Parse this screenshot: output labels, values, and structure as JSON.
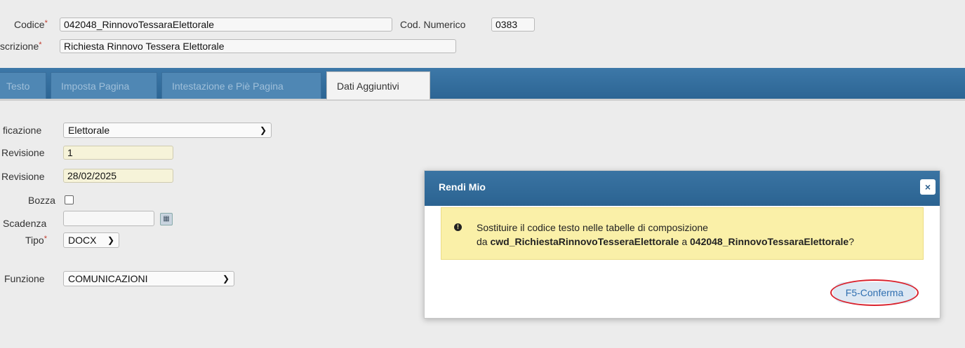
{
  "header": {
    "codice_label": "Codice",
    "codice_value": "042048_RinnovoTessaraElettorale",
    "cod_numerico_label": "Cod. Numerico",
    "cod_numerico_value": "0383",
    "descrizione_label": "scrizione",
    "descrizione_value": "Richiesta Rinnovo Tessera Elettorale",
    "required_mark": "*"
  },
  "tabs": [
    "Testo",
    "Imposta Pagina",
    "Intestazione e Piè Pagina",
    "Dati Aggiuntivi"
  ],
  "form": {
    "classificazione_label": "ficazione",
    "classificazione_value": "Elettorale",
    "n_revisione_label": "Revisione",
    "n_revisione_value": "1",
    "data_revisione_label": "Revisione",
    "data_revisione_value": "28/02/2025",
    "bozza_label": "Bozza",
    "scadenza_label": "Scadenza",
    "scadenza_value": "",
    "tipo_label": "Tipo",
    "tipo_value": "DOCX",
    "funzione_label": "Funzione",
    "funzione_value": "COMUNICAZIONI"
  },
  "dialog": {
    "title": "Rendi Mio",
    "close_symbol": "×",
    "message_line1": "Sostituire il codice testo nelle tabelle di composizione",
    "message_da": "da",
    "old_code": "cwd_RichiestaRinnovoTesseraElettorale",
    "message_a": "a",
    "new_code": "042048_RinnovoTessaraElettorale",
    "message_end": "?",
    "confirm_label": "F5-Conferma"
  },
  "icons": {
    "dropdown": "chevron-down-icon",
    "calendar": "calendar-icon",
    "alert": "exclamation-circle-icon",
    "close": "close-icon"
  },
  "colors": {
    "accent_blue": "#2c6594",
    "alert_yellow": "#faf0a8",
    "highlight_red": "#d9232e"
  }
}
